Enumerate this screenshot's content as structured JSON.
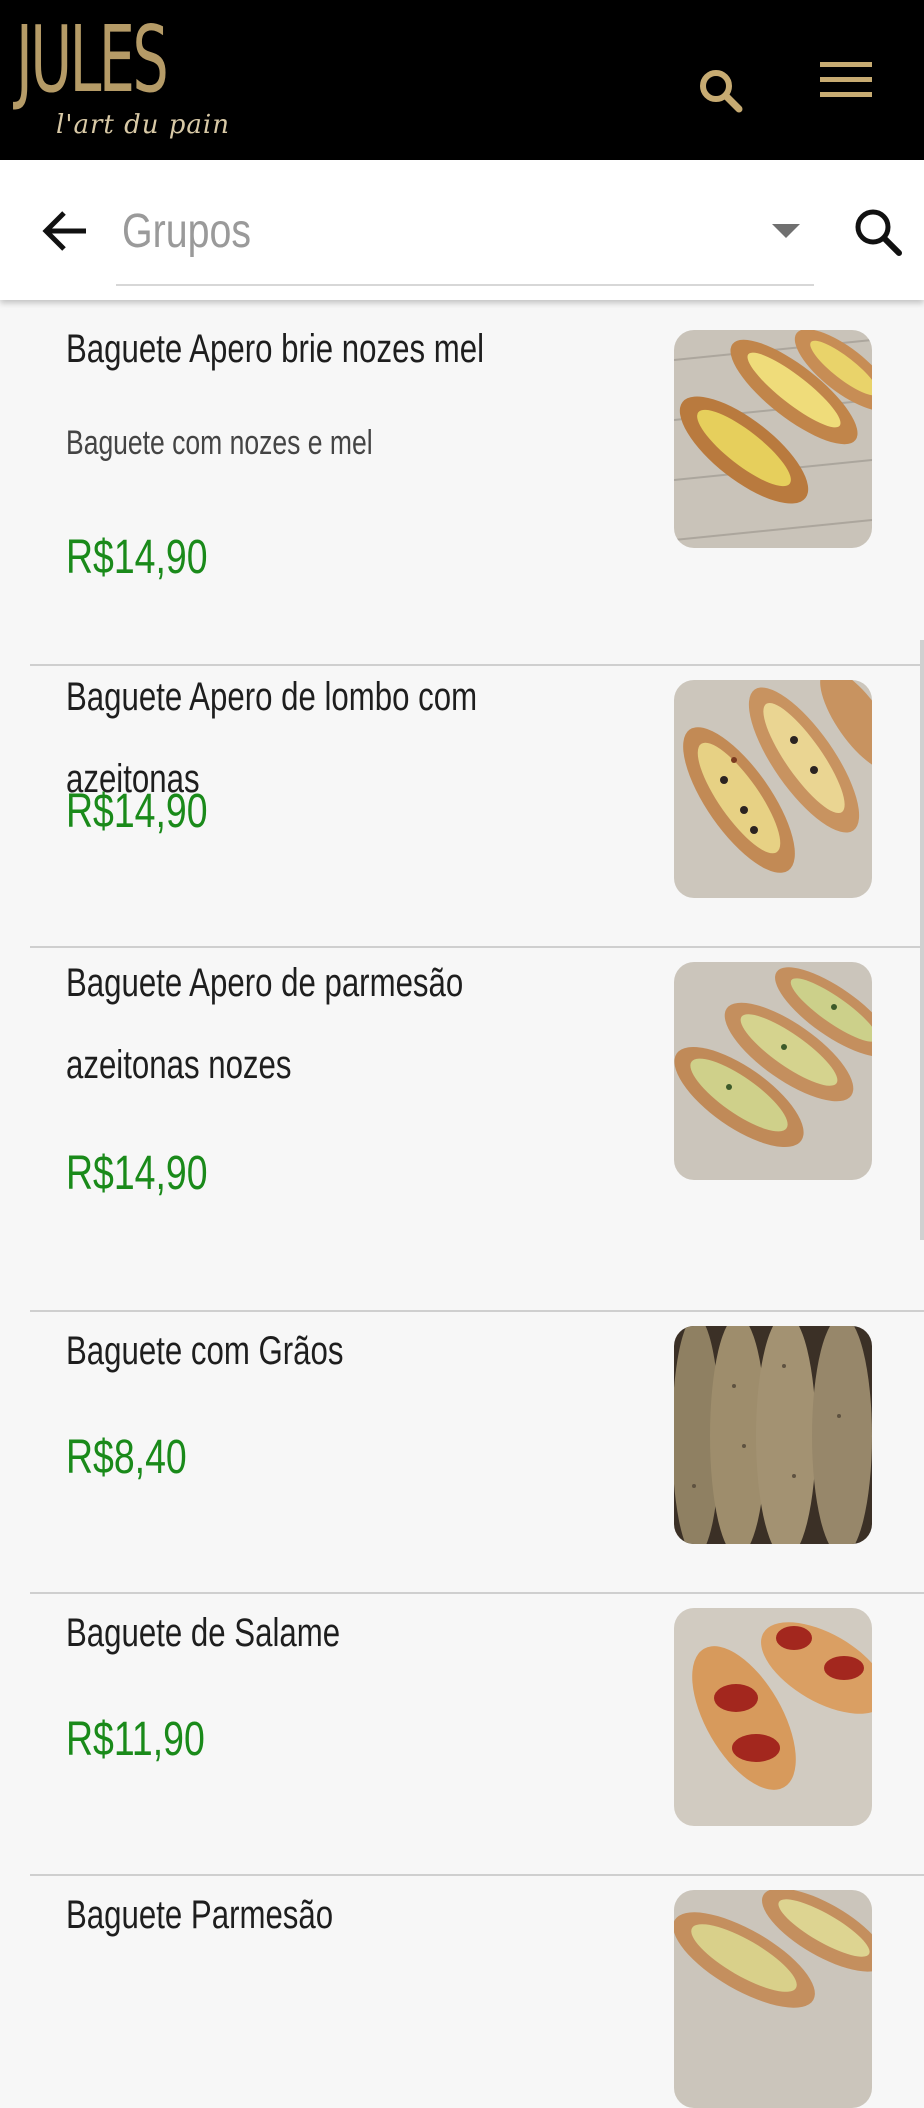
{
  "header": {
    "logo_word": "JULES",
    "logo_tagline": "l'art du pain",
    "search_icon": "search-icon",
    "menu_icon": "hamburger-menu-icon"
  },
  "filter_bar": {
    "back_icon": "arrow-left-icon",
    "groups_placeholder": "Grupos",
    "dropdown_icon": "caret-down-icon",
    "search_icon": "search-icon"
  },
  "colors": {
    "header_bg": "#000000",
    "brand_gold": "#b59b67",
    "price_green": "#1a8a1a",
    "page_bg": "#f7f7f7"
  },
  "products": [
    {
      "name": "Baguete Apero brie nozes mel",
      "description": "Baguete com nozes e mel",
      "price": "R$14,90",
      "image": "baguette-brie-photo"
    },
    {
      "name": "Baguete Apero de lombo com azeitonas",
      "description": "",
      "price": "R$14,90",
      "image": "baguette-lombo-photo"
    },
    {
      "name": "Baguete Apero de parmesão azeitonas nozes",
      "description": "",
      "price": "R$14,90",
      "image": "baguette-parmesao-photo"
    },
    {
      "name": "Baguete com Grãos",
      "description": "",
      "price": "R$8,40",
      "image": "baguette-graos-photo"
    },
    {
      "name": "Baguete de Salame",
      "description": "",
      "price": "R$11,90",
      "image": "baguette-salame-photo"
    },
    {
      "name": "Baguete Parmesão",
      "description": "",
      "price": "",
      "image": "baguette-parmesao-cheese-photo"
    }
  ]
}
